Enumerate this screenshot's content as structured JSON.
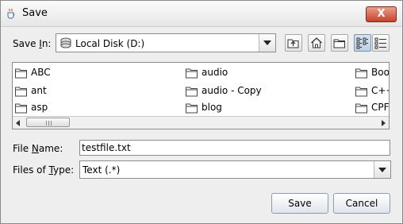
{
  "window": {
    "title": "Save",
    "close_label": "X"
  },
  "save_in": {
    "label_pre": "Save ",
    "label_key": "I",
    "label_post": "n:",
    "value": "Local Disk (D:)"
  },
  "toolbar": {
    "buttons": [
      "up-one-level",
      "home",
      "new-folder",
      "list-view",
      "details-view"
    ],
    "selected": "list-view"
  },
  "files": {
    "columns": [
      [
        "ABC",
        "ant",
        "asp"
      ],
      [
        "audio",
        "audio - Copy",
        "blog"
      ],
      [
        "Boo",
        "C++",
        "CPF"
      ]
    ]
  },
  "file_name": {
    "label_pre": "File ",
    "label_key": "N",
    "label_post": "ame:",
    "value": "testfile.txt"
  },
  "files_of_type": {
    "label_pre": "Files of ",
    "label_key": "T",
    "label_post": "ype:",
    "value": "Text (.*)"
  },
  "actions": {
    "save": "Save",
    "cancel": "Cancel"
  }
}
